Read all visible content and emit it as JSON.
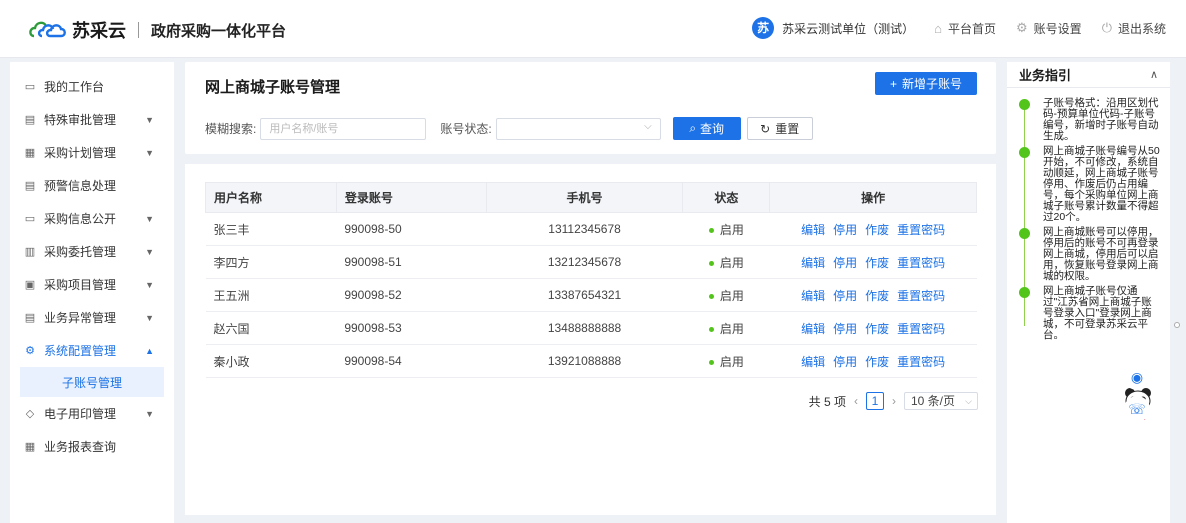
{
  "header": {
    "brand": "苏采云",
    "subtitle": "政府采购一体化平台",
    "unit_badge": "苏",
    "unit_name": "苏采云测试单位（测试）",
    "links": [
      {
        "icon": "home-icon",
        "label": "平台首页"
      },
      {
        "icon": "gear-icon",
        "label": "账号设置"
      },
      {
        "icon": "power-icon",
        "label": "退出系统"
      }
    ]
  },
  "sidebar": {
    "items": [
      {
        "label": "我的工作台",
        "icon": "monitor-icon",
        "expandable": false
      },
      {
        "label": "特殊审批管理",
        "icon": "clipboard-icon",
        "expandable": true
      },
      {
        "label": "采购计划管理",
        "icon": "calendar-icon",
        "expandable": true
      },
      {
        "label": "预警信息处理",
        "icon": "clipboard-icon",
        "expandable": false
      },
      {
        "label": "采购信息公开",
        "icon": "monitor-icon",
        "expandable": true
      },
      {
        "label": "采购委托管理",
        "icon": "document-icon",
        "expandable": true
      },
      {
        "label": "采购项目管理",
        "icon": "list-icon",
        "expandable": true
      },
      {
        "label": "业务异常管理",
        "icon": "clipboard-icon",
        "expandable": true
      },
      {
        "label": "系统配置管理",
        "icon": "gear-icon",
        "expandable": true,
        "expanded": true
      },
      {
        "label": "电子用印管理",
        "icon": "tag-icon",
        "expandable": true
      },
      {
        "label": "业务报表查询",
        "icon": "table-icon",
        "expandable": false
      }
    ],
    "active_sub": "子账号管理"
  },
  "main": {
    "title": "网上商城子账号管理",
    "add_button": "新增子账号",
    "filters": {
      "search_label": "模糊搜索:",
      "search_placeholder": "用户名称/账号",
      "status_label": "账号状态:",
      "query_button": "查询",
      "reset_button": "重置"
    },
    "table": {
      "headers": [
        "用户名称",
        "登录账号",
        "手机号",
        "状态",
        "操作"
      ],
      "rows": [
        {
          "name": "张三丰",
          "account": "990098-50",
          "phone": "13112345678",
          "status": "启用"
        },
        {
          "name": "李四方",
          "account": "990098-51",
          "phone": "13212345678",
          "status": "启用"
        },
        {
          "name": "王五洲",
          "account": "990098-52",
          "phone": "13387654321",
          "status": "启用"
        },
        {
          "name": "赵六国",
          "account": "990098-53",
          "phone": "13488888888",
          "status": "启用"
        },
        {
          "name": "秦小政",
          "account": "990098-54",
          "phone": "13921088888",
          "status": "启用"
        }
      ],
      "actions": [
        "编辑",
        "停用",
        "作废",
        "重置密码"
      ]
    },
    "pager": {
      "total": "共 5 项",
      "current": "1",
      "page_size": "10 条/页"
    }
  },
  "guide": {
    "title": "业务指引",
    "items": [
      "子账号格式：沿用区划代码-预算单位代码-子账号编号，新增时子账号自动生成。",
      "网上商城子账号编号从50开始，不可修改，系统自动顺延，网上商城子账号停用、作废后仍占用编号，每个采购单位网上商城子账号累计数量不得超过20个。",
      "网上商城账号可以停用，停用后的账号不可再登录网上商城，停用后可以启用，恢复账号登录网上商城的权限。",
      "网上商城子账号仅通过\"江苏省网上商城子账号登录入口\"登录网上商城，不可登录苏采云平台。"
    ]
  },
  "colors": {
    "primary": "#1c72e6",
    "status_green": "#52c41a",
    "background": "#eef1f6"
  }
}
